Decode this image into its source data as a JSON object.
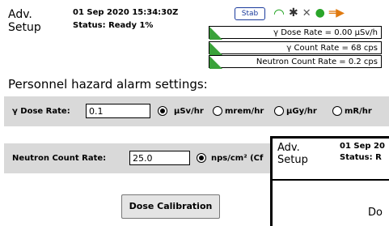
{
  "header": {
    "title": "Adv.\nSetup",
    "datetime": "01 Sep 2020 15:34:30Z",
    "status": "Status: Ready 1%",
    "stab_label": "Stab",
    "icons": [
      "wifi-icon",
      "bluetooth-icon",
      "gps-off-icon",
      "location-icon",
      "battery-plug-icon"
    ]
  },
  "rates": {
    "dose_rate": "γ Dose Rate = 0.00 µSv/h",
    "count_rate": "γ Count Rate = 68 cps",
    "neutron_rate": "Neutron Count Rate = 0.2 cps"
  },
  "main": {
    "section_title": "Personnel hazard alarm settings:",
    "dose": {
      "label": "γ Dose Rate:",
      "value": "0.1",
      "units": [
        "µSv/hr",
        "mrem/hr",
        "µGy/hr",
        "mR/hr"
      ],
      "selected": "µSv/hr"
    },
    "neutron": {
      "label": "Neutron Count Rate:",
      "value": "25.0",
      "unit_label": "nps/cm² (Cf"
    },
    "calibration_button": "Dose Calibration"
  },
  "popup": {
    "title": "Adv.\nSetup",
    "datetime": "01 Sep 20",
    "status": "Status: R",
    "partial_text": "Do"
  }
}
